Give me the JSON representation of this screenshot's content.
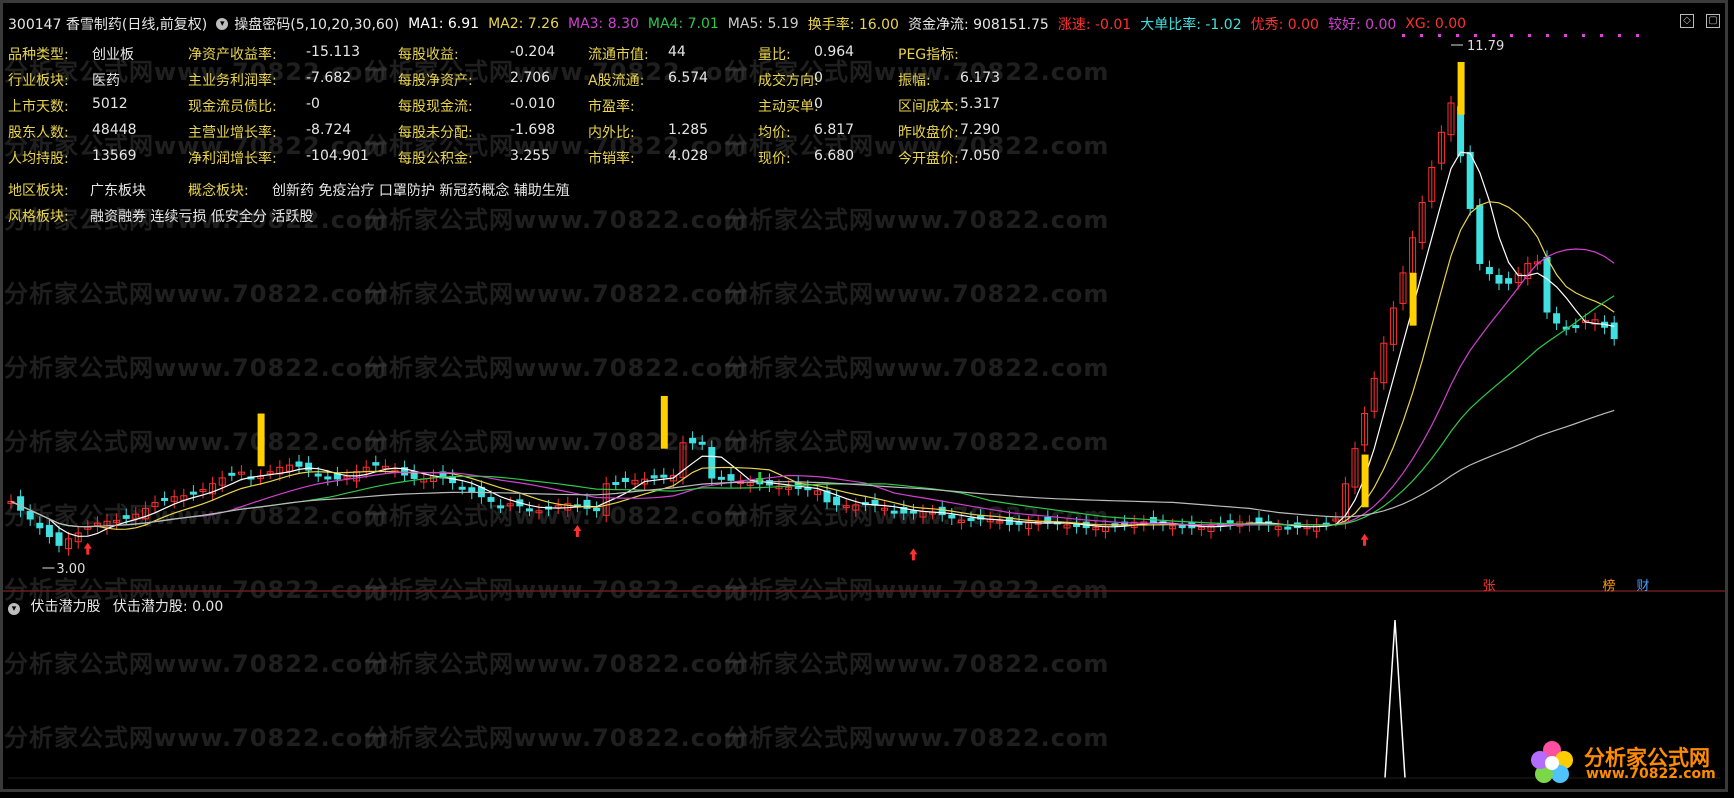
{
  "header": {
    "stock": "300147 香雪制药(日线,前复权)",
    "indicator": "操盘密码(5,10,20,30,60)",
    "ma1": "MA1: 6.91",
    "ma2": "MA2: 7.26",
    "ma3": "MA3: 8.30",
    "ma4": "MA4: 7.01",
    "ma5": "MA5: 5.19",
    "turnover": "换手率: 16.00",
    "netflow": "资金净流: 908151.75",
    "speed": "涨速: -0.01",
    "bigorder": "大单比率: -1.02",
    "good": "优秀: 0.00",
    "better": "较好: 0.00",
    "xg": "XG: 0.00"
  },
  "info": [
    [
      {
        "l": "品种类型:",
        "v": "创业板"
      },
      {
        "l": "净资产收益率:",
        "v": "-15.113"
      },
      {
        "l": "每股收益:",
        "v": "-0.204"
      },
      {
        "l": "流通市值:",
        "v": "44"
      },
      {
        "l": "量比:",
        "v": "0.964"
      },
      {
        "l": "PEG指标:",
        "v": ""
      }
    ],
    [
      {
        "l": "行业板块:",
        "v": "医药"
      },
      {
        "l": "主业务利润率:",
        "v": "-7.682"
      },
      {
        "l": "每股净资产:",
        "v": "2.706"
      },
      {
        "l": "A股流通:",
        "v": "6.574"
      },
      {
        "l": "成交方向:",
        "v": "0"
      },
      {
        "l": "振幅:",
        "v": "6.173"
      }
    ],
    [
      {
        "l": "上市天数:",
        "v": "5012"
      },
      {
        "l": "现金流员债比:",
        "v": "-0"
      },
      {
        "l": "每股现金流:",
        "v": "-0.010"
      },
      {
        "l": "市盈率:",
        "v": ""
      },
      {
        "l": "主动买单:",
        "v": "0"
      },
      {
        "l": "区间成本:",
        "v": "5.317"
      }
    ],
    [
      {
        "l": "股东人数:",
        "v": "48448"
      },
      {
        "l": "主营业增长率:",
        "v": "-8.724"
      },
      {
        "l": "每股未分配:",
        "v": "-1.698"
      },
      {
        "l": "内外比:",
        "v": "1.285"
      },
      {
        "l": "均价:",
        "v": "6.817"
      },
      {
        "l": "昨收盘价:",
        "v": "7.290"
      }
    ],
    [
      {
        "l": "人均持股:",
        "v": "13569"
      },
      {
        "l": "净利润增长率:",
        "v": "-104.901"
      },
      {
        "l": "每股公积金:",
        "v": "3.255"
      },
      {
        "l": "市销率:",
        "v": "4.028"
      },
      {
        "l": "现价:",
        "v": "6.680"
      },
      {
        "l": "今开盘价:",
        "v": "7.050"
      }
    ]
  ],
  "region": {
    "l": "地区板块:",
    "v": "广东板块"
  },
  "concept": {
    "l": "概念板块:",
    "v": "创新药 免疫治疗 口罩防护 新冠药概念 辅助生殖"
  },
  "style": {
    "l": "风格板块:",
    "v": "融资融券 连续亏损 低安全分 活跃股"
  },
  "chart": {
    "high_label": "11.79",
    "low_label": "3.00",
    "tags": [
      "张",
      "榜",
      "财"
    ]
  },
  "sub": {
    "name": "伏击潜力股",
    "value": "伏击潜力股: 0.00"
  },
  "watermark": "分析家公式网www.70822.com",
  "logo": {
    "name": "分析家公式网",
    "url": "www.70822.com"
  },
  "colors": {
    "ma1": "#ffffff",
    "ma2": "#e8d44d",
    "ma3": "#d040d0",
    "ma4": "#2fc84a",
    "ma5": "#bbbbbb",
    "up": "#ff3030",
    "down": "#40e0e0"
  }
}
